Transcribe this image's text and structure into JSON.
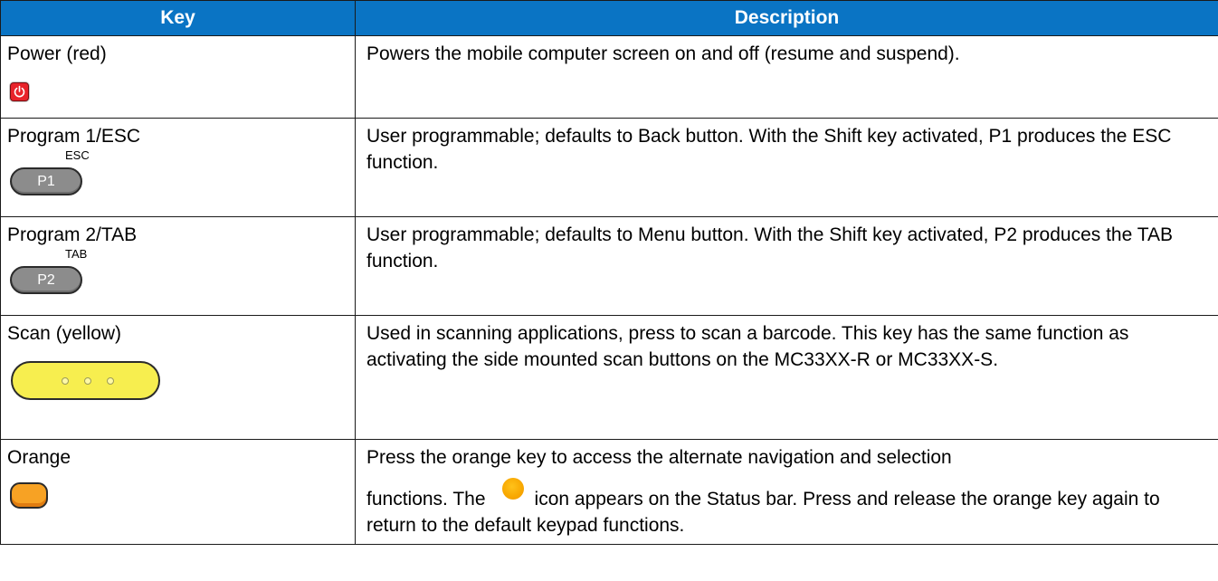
{
  "table": {
    "headers": {
      "key": "Key",
      "description": "Description"
    },
    "rows": [
      {
        "key": "Power (red)",
        "icon": "power-icon",
        "description": "Powers the mobile computer screen on and off (resume and suspend)."
      },
      {
        "key": "Program 1/ESC",
        "icon": "p1-key-icon",
        "key_cap": "P1",
        "key_super": "ESC",
        "description": "User programmable; defaults to Back button. With the Shift key activated, P1 produces the ESC function."
      },
      {
        "key": "Program 2/TAB",
        "icon": "p2-key-icon",
        "key_cap": "P2",
        "key_super": "TAB",
        "description": "User programmable; defaults to Menu button. With the Shift key activated, P2 produces the TAB function."
      },
      {
        "key": "Scan (yellow)",
        "icon": "scan-key-icon",
        "description": "Used in scanning applications, press to scan a barcode. This key has the same function as activating the side mounted scan buttons on the MC33XX-R or MC33XX-S."
      },
      {
        "key": "Orange",
        "icon": "orange-key-icon",
        "description_part1": "Press the orange key to access the alternate navigation and selection",
        "description_part2a": "functions. The",
        "description_part2b": "icon appears on the Status bar. Press and release the orange key again to return to the default keypad functions."
      }
    ]
  },
  "colors": {
    "header_bg": "#0a74c4",
    "power_red": "#e8232a",
    "program_gray": "#8c8c8c",
    "scan_yellow": "#f7ee4f",
    "orange": "#f7a224"
  }
}
